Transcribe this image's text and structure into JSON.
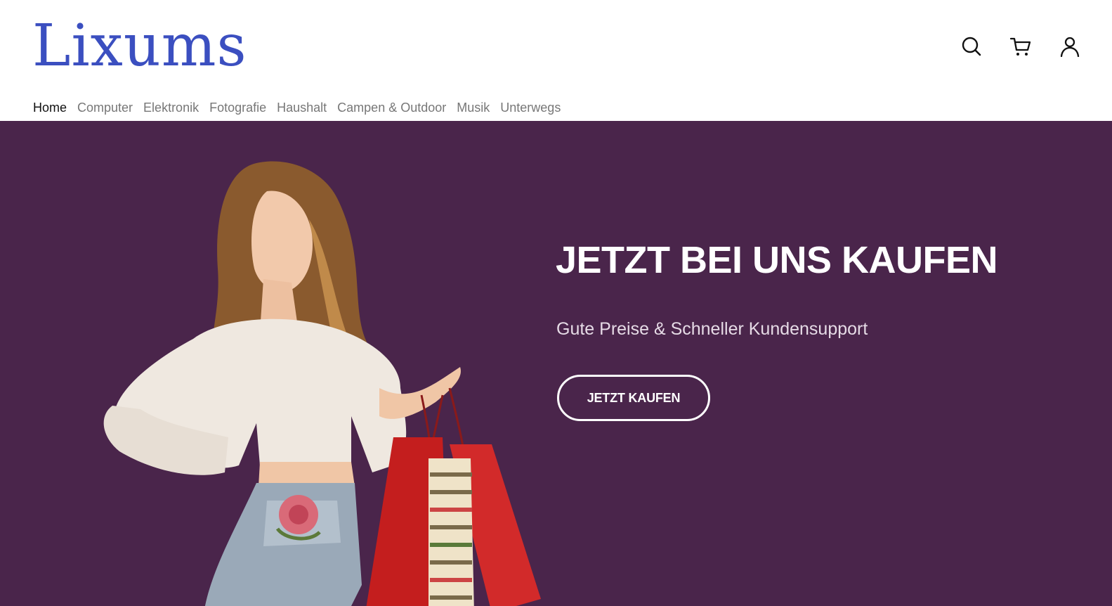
{
  "header": {
    "logo_text": "Lixums",
    "icons": [
      "search-icon",
      "cart-icon",
      "user-icon"
    ]
  },
  "nav": {
    "items": [
      {
        "label": "Home",
        "active": true
      },
      {
        "label": "Computer",
        "active": false
      },
      {
        "label": "Elektronik",
        "active": false
      },
      {
        "label": "Fotografie",
        "active": false
      },
      {
        "label": "Haushalt",
        "active": false
      },
      {
        "label": "Campen & Outdoor",
        "active": false
      },
      {
        "label": "Musik",
        "active": false
      },
      {
        "label": "Unterwegs",
        "active": false
      }
    ]
  },
  "hero": {
    "title": "JETZT BEI UNS KAUFEN",
    "subtitle": "Gute Preise & Schneller Kundensupport",
    "cta_label": "JETZT KAUFEN",
    "image_subject": "woman-with-shopping-bags"
  },
  "colors": {
    "brand": "#3b4fc0",
    "hero_background": "#4a254b",
    "nav_text": "#777777",
    "nav_active": "#111111"
  }
}
